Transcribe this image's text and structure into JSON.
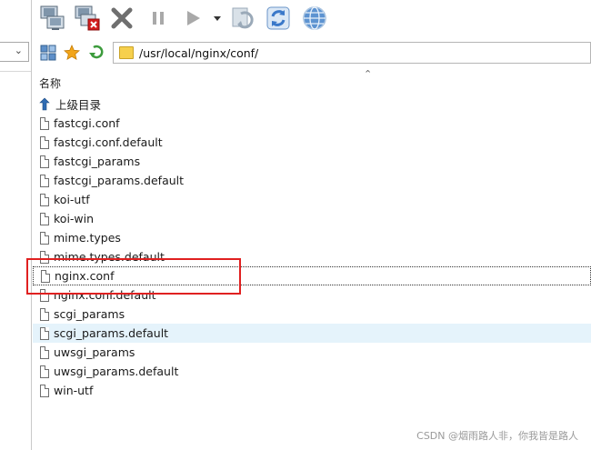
{
  "toolbar": {
    "buttons": [
      {
        "name": "connect-computer-icon",
        "color": "#6a7a8a"
      },
      {
        "name": "disconnect-computer-icon",
        "color": "#d21e1e"
      },
      {
        "name": "cancel-x-icon",
        "color": "#6f6f6f"
      },
      {
        "name": "pause-icon",
        "color": "#a9a9a9"
      },
      {
        "name": "play-icon",
        "color": "#a9a9a9"
      },
      {
        "name": "dropdown-arrow-icon",
        "color": "#333333"
      },
      {
        "name": "sync-dim-icon",
        "color": "#9aa9b8"
      },
      {
        "name": "refresh-icon",
        "color": "#3a78c9"
      },
      {
        "name": "globe-icon",
        "color": "#2d6fb5"
      }
    ]
  },
  "address": {
    "path": "/usr/local/nginx/conf/"
  },
  "list": {
    "header": "名称",
    "parent_label": "上级目录",
    "files": [
      "fastcgi.conf",
      "fastcgi.conf.default",
      "fastcgi_params",
      "fastcgi_params.default",
      "koi-utf",
      "koi-win",
      "mime.types",
      "mime.types.default",
      "nginx.conf",
      "nginx.conf.default",
      "scgi_params",
      "scgi_params.default",
      "uwsgi_params",
      "uwsgi_params.default",
      "win-utf"
    ],
    "focused_file": "nginx.conf",
    "hovered_file": "scgi_params.default"
  },
  "colors": {
    "highlight": "#e02020",
    "hover": "#e5f3fb"
  },
  "watermark": "CSDN @烟雨路人非，你我皆是路人"
}
